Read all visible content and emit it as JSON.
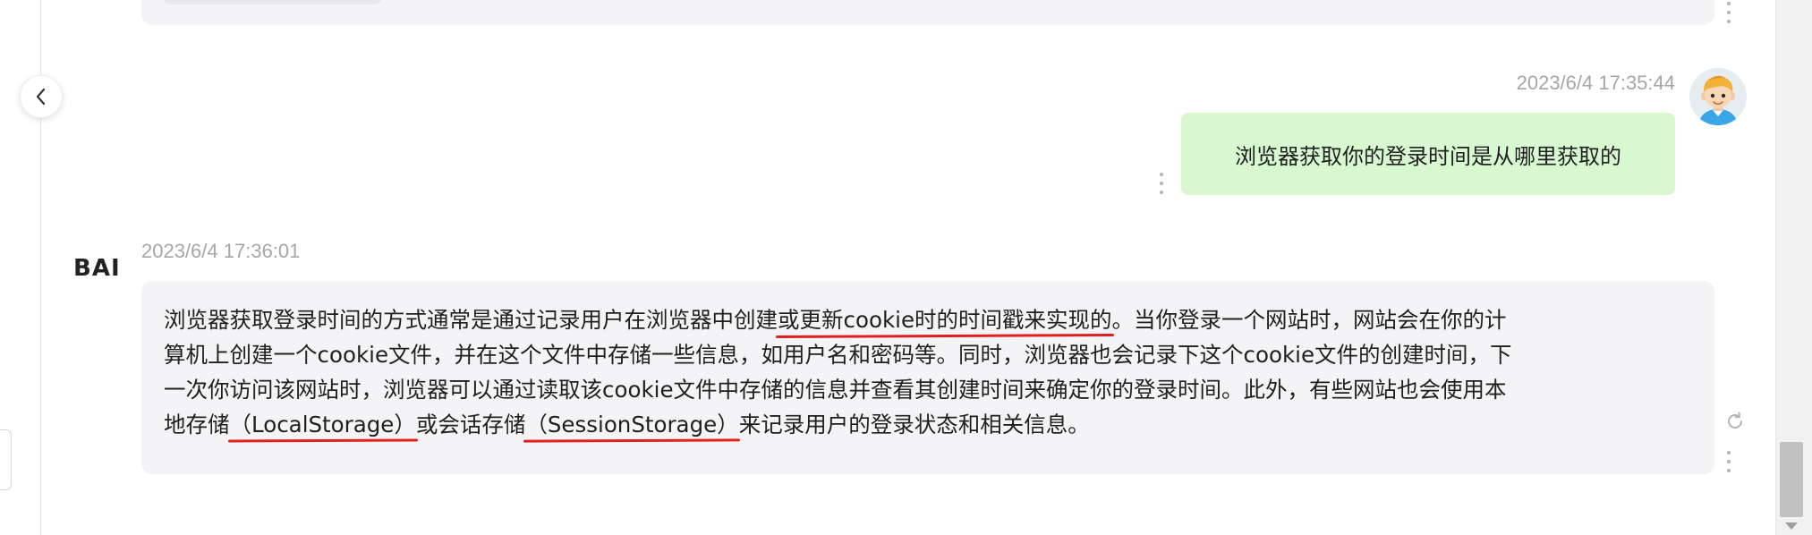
{
  "user_message": {
    "timestamp": "2023/6/4 17:35:44",
    "text": "浏览器获取你的登录时间是从哪里获取的",
    "bubble_color": "#d8f8d2",
    "avatar_icon": "cartoon-user-avatar"
  },
  "ai_message": {
    "logo": "BAI",
    "timestamp": "2023/6/4 17:36:01",
    "lines": [
      {
        "pre": "浏览器获取登录时间的方式通常是通过记录用户在浏览器中创建",
        "highlight": "或更新cookie时的时间戳来实现的",
        "post": "。当你登录一个网站时，网站会在你的计"
      },
      {
        "text": "算机上创建一个cookie文件，并在这个文件中存储一些信息，如用户名和密码等。同时，浏览器也会记录下这个cookie文件的创建时间，下"
      },
      {
        "text": "一次你访问该网站时，浏览器可以通过读取该cookie文件中存储的信息并查看其创建时间来确定你的登录时间。此外，有些网站也会使用本"
      },
      {
        "pre": "地存储",
        "highlight1": "（LocalStorage）",
        "mid": "或会话存储",
        "highlight2": "（SessionStorage）",
        "post": "来记录用户的登录状态和相关信息。"
      }
    ],
    "bubble_color": "#f4f4f6",
    "annotation_color": "#e02020"
  },
  "icons": {
    "collapse": "chevron-left-icon",
    "message_menu": "more-vertical-icon",
    "regenerate": "refresh-icon"
  }
}
